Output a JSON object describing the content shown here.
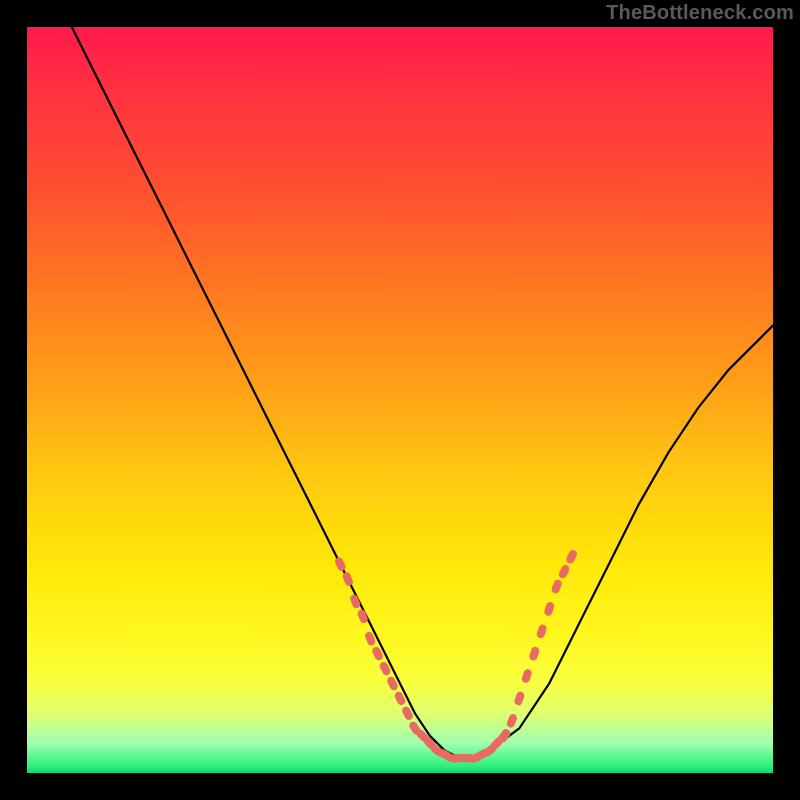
{
  "watermark": "TheBottleneck.com",
  "chart_data": {
    "type": "line",
    "title": "",
    "xlabel": "",
    "ylabel": "",
    "xlim": [
      0,
      100
    ],
    "ylim": [
      0,
      100
    ],
    "grid": false,
    "series": [
      {
        "name": "curve",
        "color": "#000000",
        "x": [
          6,
          10,
          14,
          18,
          22,
          26,
          30,
          34,
          38,
          42,
          46,
          48,
          50,
          52,
          54,
          56,
          58,
          60,
          62,
          66,
          70,
          74,
          78,
          82,
          86,
          90,
          94,
          98,
          100
        ],
        "y": [
          100,
          92,
          84,
          76,
          68,
          60,
          52,
          44,
          36,
          28,
          20,
          16,
          12,
          8,
          5,
          3,
          2,
          2,
          3,
          6,
          12,
          20,
          28,
          36,
          43,
          49,
          54,
          58,
          60
        ]
      }
    ],
    "markers": [
      {
        "name": "dotted-left",
        "color": "#e86a60",
        "style": "dotted",
        "x": [
          42,
          43,
          44,
          45,
          46,
          47,
          48,
          49,
          50,
          51,
          52,
          53,
          54
        ],
        "y": [
          28,
          26,
          23,
          21,
          18,
          16,
          14,
          12,
          10,
          8,
          6,
          5,
          4
        ]
      },
      {
        "name": "dotted-bottom",
        "color": "#e86a60",
        "style": "dotted",
        "x": [
          54,
          55,
          56,
          57,
          58,
          59,
          60,
          61,
          62,
          63,
          64
        ],
        "y": [
          4,
          3,
          2.5,
          2,
          2,
          2,
          2,
          2.5,
          3,
          4,
          5
        ]
      },
      {
        "name": "dotted-right",
        "color": "#e86a60",
        "style": "dotted",
        "x": [
          64,
          65,
          66,
          67,
          68,
          69,
          70,
          71,
          72,
          73
        ],
        "y": [
          5,
          7,
          10,
          13,
          16,
          19,
          22,
          25,
          27,
          29
        ]
      }
    ]
  }
}
